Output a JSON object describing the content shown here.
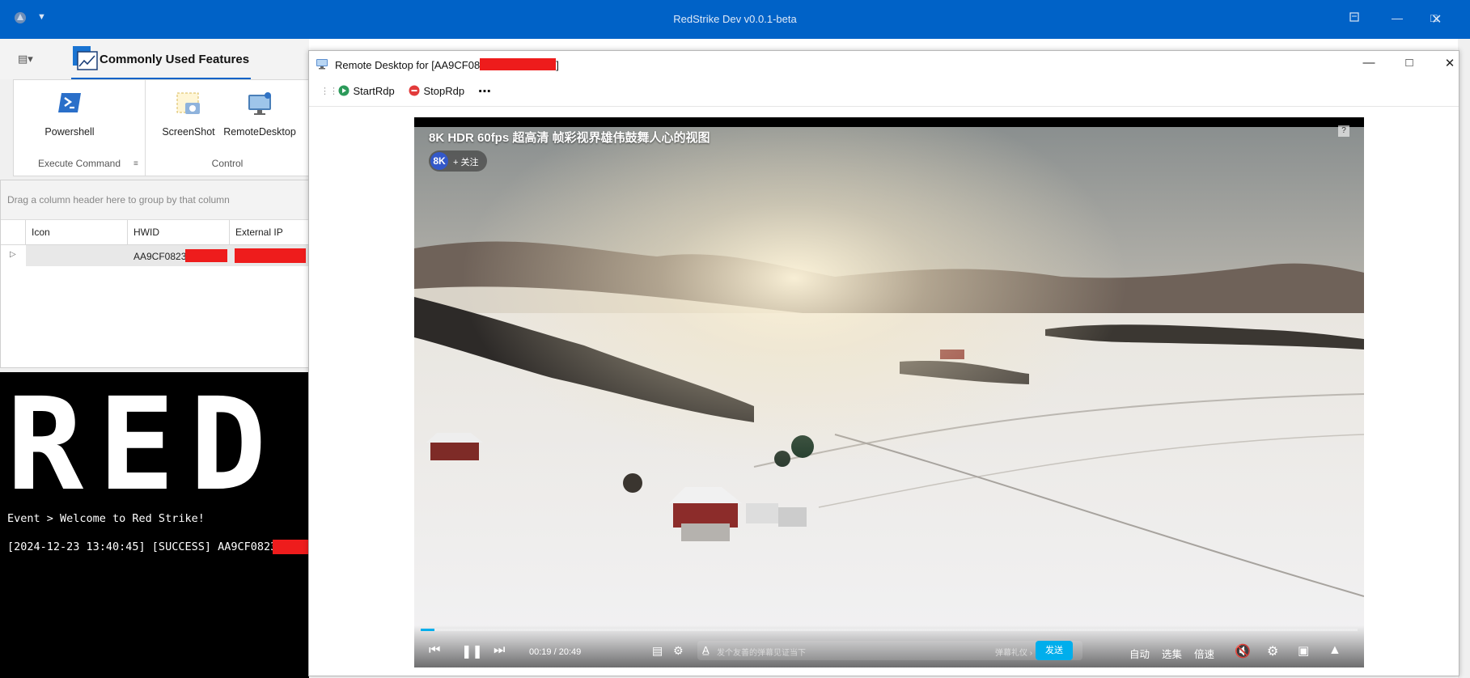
{
  "app": {
    "title": "RedStrike Dev v0.0.1-beta"
  },
  "ribbon": {
    "tab_label": "Commonly Used Features",
    "buttons": [
      {
        "label": "Powershell",
        "icon": "powershell-icon"
      },
      {
        "label": "ScreenShot",
        "icon": "screenshot-icon"
      },
      {
        "label": "RemoteDesktop",
        "icon": "remote-desktop-icon"
      }
    ],
    "groups": {
      "execute": "Execute Command",
      "control": "Control"
    }
  },
  "grid": {
    "group_hint": "Drag a column header here to group by that column",
    "columns": [
      "Icon",
      "HWID",
      "External IP"
    ],
    "rows": [
      {
        "hwid": "AA9CF0823"
      }
    ]
  },
  "console": {
    "banner": "RED S",
    "lines": [
      "Event > Welcome to Red Strike!",
      "[2024-12-23 13:40:45] [SUCCESS] AA9CF0823"
    ]
  },
  "rdp": {
    "title": "Remote Desktop for [AA9CF08",
    "title_suffix": "]",
    "start_label": "StartRdp",
    "stop_label": "StopRdp",
    "more_label": "⋯"
  },
  "video": {
    "title": "8K HDR 60fps 超高清 帧彩视界雄伟鼓舞人心的视图",
    "channel_badge": "8K",
    "follow_label": "+ 关注",
    "help_label": "?",
    "time_current": "00:19",
    "time_total": "20:49",
    "time_sep": " / ",
    "progress": 0.015,
    "danmaku_placeholder": "发个友善的弹幕见证当下",
    "danmaku_etiquette": "弹幕礼仪 ›",
    "send_label": "发送",
    "quality_label": "自动",
    "episodes_label": "选集",
    "speed_label": "倍速",
    "accent_color": "#00aeec"
  }
}
